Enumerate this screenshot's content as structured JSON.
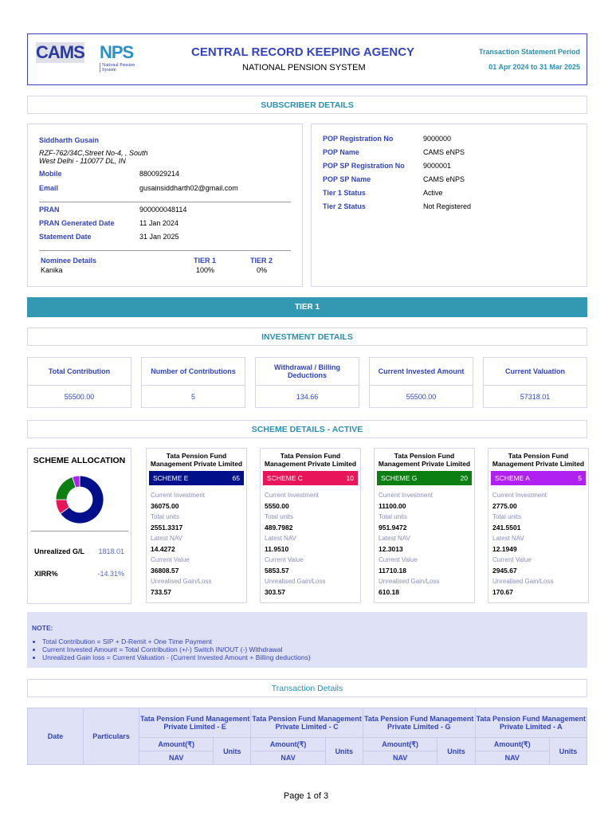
{
  "header": {
    "logo_cams": "CAMS",
    "logo_nps": "NPS",
    "logo_sub": "National Pension System",
    "title": "CENTRAL RECORD KEEPING AGENCY",
    "subtitle": "NATIONAL PENSION SYSTEM",
    "period_label": "Transaction Statement Period",
    "period": "01 Apr 2024 to 31 Mar 2025"
  },
  "subscriber_title": "SUBSCRIBER DETAILS",
  "subscriber": {
    "name": "Siddharth Gusain",
    "address1": "RZF-762/34C,Street No-4, , South",
    "address2": "West Delhi - 110077 DL, IN",
    "fields": [
      {
        "label": "Mobile",
        "value": "8800929214"
      },
      {
        "label": "Email",
        "value": "gusainsiddharth02@gmail.com"
      }
    ],
    "pran_fields": [
      {
        "label": "PRAN",
        "value": "900000048114"
      },
      {
        "label": "PRAN Generated Date",
        "value": "11 Jan 2024"
      },
      {
        "label": "Statement Date",
        "value": "31 Jan 2025"
      }
    ],
    "nominee": {
      "header": "Nominee Details",
      "tier1_header": "TIER 1",
      "tier2_header": "TIER 2",
      "name": "Kanika",
      "tier1": "100%",
      "tier2": "0%"
    }
  },
  "pop": [
    {
      "label": "POP Registration No",
      "value": "9000000"
    },
    {
      "label": "POP Name",
      "value": "CAMS eNPS"
    },
    {
      "label": "POP SP Registration No",
      "value": "9000001"
    },
    {
      "label": "POP SP Name",
      "value": "CAMS eNPS"
    },
    {
      "label": "Tier 1 Status",
      "value": "Active"
    },
    {
      "label": "Tier 2 Status",
      "value": "Not Registered"
    }
  ],
  "tier_title": "TIER 1",
  "investment_title": "INVESTMENT DETAILS",
  "investment": [
    {
      "label": "Total Contribution",
      "value": "55500.00"
    },
    {
      "label": "Number of Contributions",
      "value": "5"
    },
    {
      "label": "Withdrawal / Billing Deductions",
      "value": "134.66"
    },
    {
      "label": "Current Invested Amount",
      "value": "55500.00"
    },
    {
      "label": "Current Valuation",
      "value": "57318.01"
    }
  ],
  "scheme_title": "SCHEME DETAILS - ACTIVE",
  "allocation": {
    "title": "SCHEME ALLOCATION",
    "gl_label": "Unrealized G/L",
    "gl_value": "1818.01",
    "xirr_label": "XIRR%",
    "xirr_value": "-14.31%"
  },
  "field_labels": {
    "ci": "Current Investment",
    "tu": "Total units",
    "nav": "Latest NAV",
    "cv": "Current Value",
    "ug": "Unrealised Gain/Loss"
  },
  "schemes": [
    {
      "fund": "Tata Pension Fund Management Private Limited",
      "name": "SCHEME E",
      "pct": 65,
      "color": "#00108a",
      "ci": "36075.00",
      "tu": "2551.3317",
      "nav": "14.4272",
      "cv": "36808.57",
      "ug": "733.57"
    },
    {
      "fund": "Tata Pension Fund Management Private Limited",
      "name": "SCHEME C",
      "pct": 10,
      "color": "#e8155a",
      "ci": "5550.00",
      "tu": "489.7982",
      "nav": "11.9510",
      "cv": "5853.57",
      "ug": "303.57"
    },
    {
      "fund": "Tata Pension Fund Management Private Limited",
      "name": "SCHEME G",
      "pct": 20,
      "color": "#0b7f12",
      "ci": "11100.00",
      "tu": "951.9472",
      "nav": "12.3013",
      "cv": "11710.18",
      "ug": "610.18"
    },
    {
      "fund": "Tata Pension Fund Management Private Limited",
      "name": "SCHEME A",
      "pct": 5,
      "color": "#b020f0",
      "ci": "2775.00",
      "tu": "241.5501",
      "nav": "12.1949",
      "cv": "2945.67",
      "ug": "170.67"
    }
  ],
  "note": {
    "title": "NOTE:",
    "items": [
      "Total Contribution = SIP + D-Remit + One Time Payment",
      "Current Invested Amount = Total Contribution (+/-) Switch IN/OUT (-) Withdrawal",
      "Unrealized Gain loss = Current Valuation - (Current Invested Amount + Billing deductions)"
    ]
  },
  "transaction_title": "Transaction Details",
  "table": {
    "date": "Date",
    "particulars": "Particulars",
    "funds": [
      "Tata Pension Fund Management Private Limited - E",
      "Tata Pension Fund Management Private Limited - C",
      "Tata Pension Fund Management Private Limited - G",
      "Tata Pension Fund Management Private Limited - A"
    ],
    "amount": "Amount(₹)",
    "units": "Units",
    "nav": "NAV"
  },
  "footer": "Page 1 of 3"
}
